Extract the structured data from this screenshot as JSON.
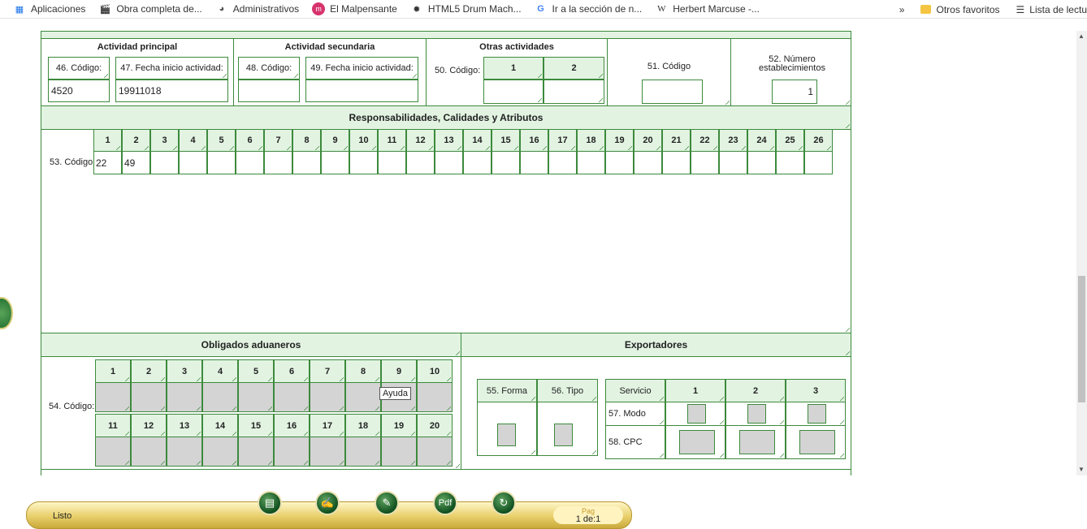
{
  "bookmarks": [
    {
      "label": "Aplicaciones",
      "icon": "apps-grid-icon"
    },
    {
      "label": "Obra completa de...",
      "icon": "film-icon"
    },
    {
      "label": "Administrativos",
      "icon": "globe-icon"
    },
    {
      "label": "El Malpensante",
      "icon": "m-circle-icon"
    },
    {
      "label": "HTML5 Drum Mach...",
      "icon": "drum-icon"
    },
    {
      "label": "Ir a la sección de n...",
      "icon": "google-icon"
    },
    {
      "label": "Herbert Marcuse -...",
      "icon": "wikipedia-icon"
    }
  ],
  "bookmarks_right": {
    "more": "»",
    "otros": "Otros favoritos",
    "lista": "Lista de lectu"
  },
  "actividad_principal": {
    "title": "Actividad principal",
    "codigo_label": "46. Código:",
    "fecha_label": "47. Fecha inicio actividad:",
    "codigo_value": "4520",
    "fecha_value": "19911018"
  },
  "actividad_secundaria": {
    "title": "Actividad secundaria",
    "codigo_label": "48. Código:",
    "fecha_label": "49. Fecha inicio actividad:"
  },
  "otras_actividades": {
    "title": "Otras actividades",
    "codigo_label": "50. Código:",
    "col1": "1",
    "col2": "2"
  },
  "codigo51": {
    "label": "51. Código"
  },
  "num_est": {
    "label": "52. Número establecimientos",
    "value": "1"
  },
  "responsabilidades": {
    "title": "Responsabilidades, Calidades y Atributos",
    "row_label": "53. Código",
    "columns": [
      "1",
      "2",
      "3",
      "4",
      "5",
      "6",
      "7",
      "8",
      "9",
      "10",
      "11",
      "12",
      "13",
      "14",
      "15",
      "16",
      "17",
      "18",
      "19",
      "20",
      "21",
      "22",
      "23",
      "24",
      "25",
      "26"
    ],
    "values": [
      "22",
      "49",
      "",
      "",
      "",
      "",
      "",
      "",
      "",
      "",
      "",
      "",
      "",
      "",
      "",
      "",
      "",
      "",
      "",
      "",
      "",
      "",
      "",
      "",
      "",
      ""
    ]
  },
  "obligados": {
    "title": "Obligados aduaneros",
    "row_label": "54. Código:",
    "columns_top": [
      "1",
      "2",
      "3",
      "4",
      "5",
      "6",
      "7",
      "8",
      "9",
      "10"
    ],
    "columns_bottom": [
      "11",
      "12",
      "13",
      "14",
      "15",
      "16",
      "17",
      "18",
      "19",
      "20"
    ]
  },
  "exportadores": {
    "title": "Exportadores",
    "forma_label": "55. Forma",
    "tipo_label": "56. Tipo",
    "servicio_label": "Servicio",
    "servicio_cols": [
      "1",
      "2",
      "3"
    ],
    "modo_label": "57. Modo",
    "cpc_label": "58. CPC"
  },
  "tooltip": "Ayuda",
  "footer": {
    "status": "Listo",
    "pag_label": "Pag",
    "pag_value": "1 de:1",
    "buttons": [
      "form-icon",
      "sign-icon",
      "pen-icon",
      "pdf-icon",
      "refresh-icon"
    ]
  }
}
